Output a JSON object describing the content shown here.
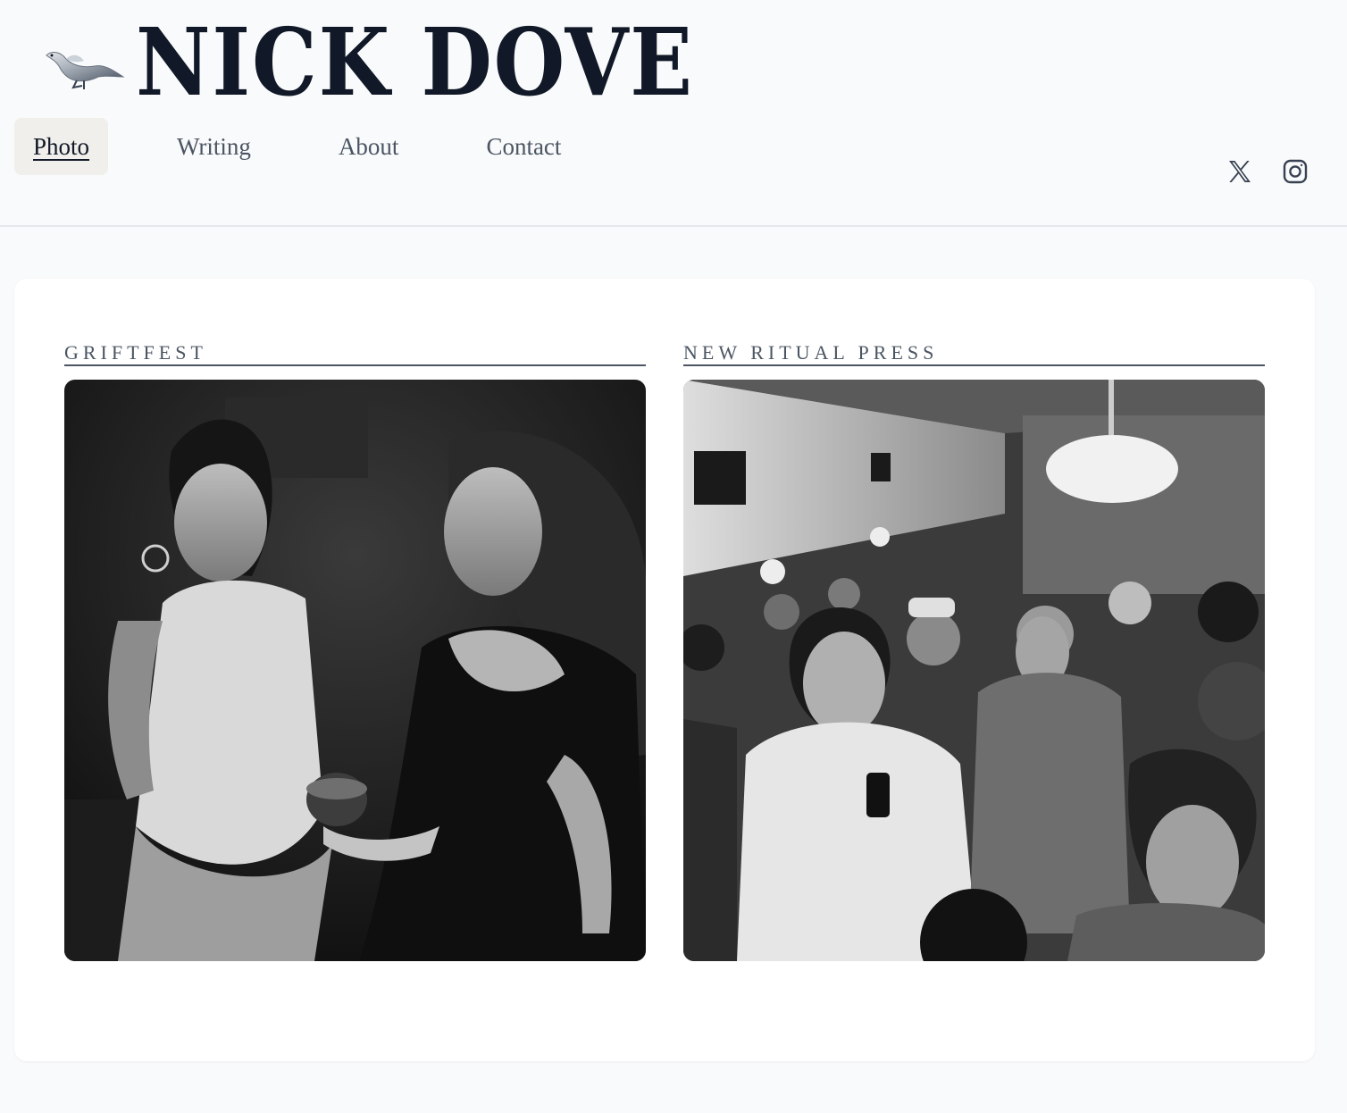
{
  "site": {
    "title": "NICK DOVE",
    "logo_icon": "dove-icon"
  },
  "nav": {
    "items": [
      {
        "label": "Photo",
        "active": true
      },
      {
        "label": "Writing",
        "active": false
      },
      {
        "label": "About",
        "active": false
      },
      {
        "label": "Contact",
        "active": false
      }
    ]
  },
  "social": {
    "icons": [
      "x-twitter-icon",
      "instagram-icon"
    ]
  },
  "gallery": {
    "albums": [
      {
        "title": "GRIFTFEST",
        "photo_icon": "griftfest-photo"
      },
      {
        "title": "NEW RITUAL PRESS",
        "photo_icon": "new-ritual-press-photo"
      }
    ]
  },
  "colors": {
    "background": "#f9fafb",
    "card": "#ffffff",
    "title": "#111827",
    "nav_text": "#4b5563",
    "nav_active_bg": "#f0efeb",
    "divider": "#e5e7eb"
  }
}
